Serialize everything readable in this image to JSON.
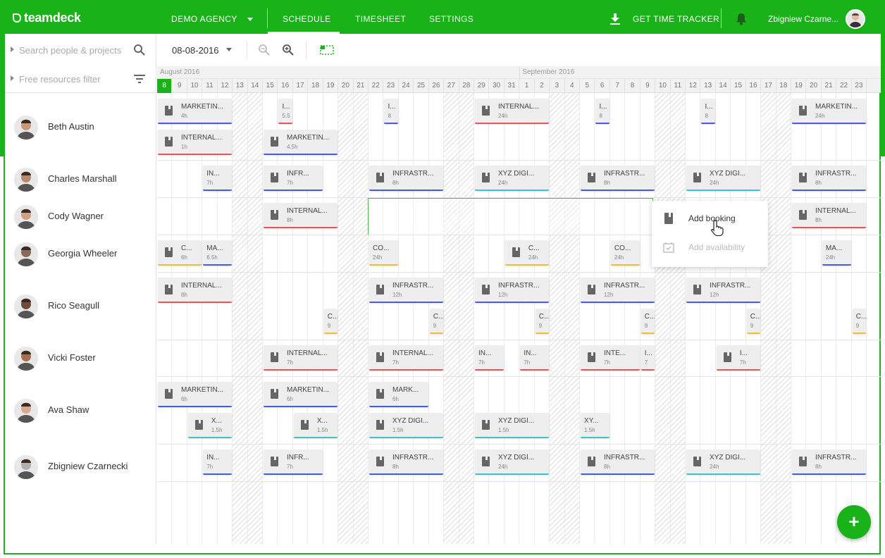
{
  "header": {
    "logo": "teamdeck",
    "agency": "DEMO AGENCY",
    "tabs": [
      {
        "label": "SCHEDULE",
        "active": true
      },
      {
        "label": "TIMESHEET",
        "active": false
      },
      {
        "label": "SETTINGS",
        "active": false
      }
    ],
    "tracker": "GET TIME TRACKER",
    "user": "Zbigniew Czarne..."
  },
  "sidebar": {
    "search_placeholder": "Search people & projects",
    "filter_placeholder": "Free resources filter",
    "people": [
      {
        "name": "Beth Austin"
      },
      {
        "name": "Charles Marshall"
      },
      {
        "name": "Cody Wagner"
      },
      {
        "name": "Georgia Wheeler"
      },
      {
        "name": "Rico Seagull"
      },
      {
        "name": "Vicki Foster"
      },
      {
        "name": "Ava Shaw"
      },
      {
        "name": "Zbigniew Czarnecki"
      }
    ]
  },
  "toolbar": {
    "date": "08-08-2016"
  },
  "timeline": {
    "months": [
      {
        "label": "August 2016",
        "start": 0
      },
      {
        "label": "September 2016",
        "start": 24
      }
    ],
    "days": [
      "8",
      "9",
      "10",
      "11",
      "12",
      "13",
      "14",
      "15",
      "16",
      "17",
      "18",
      "19",
      "20",
      "21",
      "22",
      "23",
      "24",
      "25",
      "26",
      "27",
      "28",
      "29",
      "30",
      "31",
      "1",
      "2",
      "3",
      "4",
      "5",
      "6",
      "7",
      "8",
      "9",
      "10",
      "11",
      "12",
      "13",
      "14",
      "15",
      "16",
      "17",
      "18",
      "19",
      "20",
      "21",
      "22",
      "23"
    ],
    "weekends": [
      5,
      6,
      12,
      13,
      19,
      20,
      26,
      27,
      33,
      34,
      40,
      41
    ],
    "today": 0
  },
  "context_menu": {
    "add_booking": "Add booking",
    "add_availability": "Add availability"
  },
  "colors": {
    "brand": "#19b319",
    "blue": "#4a5bdc",
    "red": "#e05a5a",
    "teal": "#3cc6c6",
    "yellow": "#e8c23a",
    "purple": "#7a88d6"
  },
  "bookings": [
    {
      "title": "MARKETIN...",
      "hours": "4h",
      "color": "blue",
      "row": 0,
      "lane": 0,
      "start": 0,
      "span": 5
    },
    {
      "title": "I...",
      "hours": "5.5",
      "color": "red",
      "row": 0,
      "lane": 0,
      "start": 8,
      "span": 1
    },
    {
      "title": "I...",
      "hours": "8",
      "color": "blue",
      "row": 0,
      "lane": 0,
      "start": 15,
      "span": 1
    },
    {
      "title": "INTERNAL...",
      "hours": "24h",
      "color": "red",
      "row": 0,
      "lane": 0,
      "start": 21,
      "span": 5
    },
    {
      "title": "I...",
      "hours": "8",
      "color": "blue",
      "row": 0,
      "lane": 0,
      "start": 29,
      "span": 1
    },
    {
      "title": "I...",
      "hours": "8",
      "color": "blue",
      "row": 0,
      "lane": 0,
      "start": 36,
      "span": 1
    },
    {
      "title": "MARKETIN...",
      "hours": "24h",
      "color": "blue",
      "row": 0,
      "lane": 0,
      "start": 42,
      "span": 5
    },
    {
      "title": "INTERNAL...",
      "hours": "1h",
      "color": "red",
      "row": 0,
      "lane": 1,
      "start": 0,
      "span": 5
    },
    {
      "title": "MARKETIN...",
      "hours": "4.5h",
      "color": "blue",
      "row": 0,
      "lane": 1,
      "start": 7,
      "span": 5
    },
    {
      "title": "IN...",
      "hours": "7h",
      "color": "blue",
      "row": 1,
      "lane": 0,
      "start": 3,
      "span": 2
    },
    {
      "title": "INFR...",
      "hours": "7h",
      "color": "blue",
      "row": 1,
      "lane": 0,
      "start": 7,
      "span": 4
    },
    {
      "title": "INFRASTR...",
      "hours": "8h",
      "color": "blue",
      "row": 1,
      "lane": 0,
      "start": 14,
      "span": 5
    },
    {
      "title": "XYZ DIGI...",
      "hours": "24h",
      "color": "teal",
      "row": 1,
      "lane": 0,
      "start": 21,
      "span": 5
    },
    {
      "title": "INFRASTR...",
      "hours": "8h",
      "color": "blue",
      "row": 1,
      "lane": 0,
      "start": 28,
      "span": 5
    },
    {
      "title": "XYZ DIGI...",
      "hours": "24h",
      "color": "teal",
      "row": 1,
      "lane": 0,
      "start": 35,
      "span": 5
    },
    {
      "title": "INFRASTR...",
      "hours": "8h",
      "color": "blue",
      "row": 1,
      "lane": 0,
      "start": 42,
      "span": 5
    },
    {
      "title": "INTERNAL...",
      "hours": "8h",
      "color": "red",
      "row": 2,
      "lane": 0,
      "start": 7,
      "span": 5
    },
    {
      "title": "INTERNAL...",
      "hours": "8h",
      "color": "red",
      "row": 2,
      "lane": 0,
      "start": 42,
      "span": 5
    },
    {
      "title": "C...",
      "hours": "6h",
      "color": "yellow",
      "row": 3,
      "lane": 0,
      "start": 0,
      "span": 3
    },
    {
      "title": "MA...",
      "hours": "6.5h",
      "color": "blue",
      "row": 3,
      "lane": 0,
      "start": 3,
      "span": 2
    },
    {
      "title": "CO...",
      "hours": "24h",
      "color": "yellow",
      "row": 3,
      "lane": 0,
      "start": 14,
      "span": 2
    },
    {
      "title": "C...",
      "hours": "24h",
      "color": "yellow",
      "row": 3,
      "lane": 0,
      "start": 23,
      "span": 3
    },
    {
      "title": "CO...",
      "hours": "24h",
      "color": "yellow",
      "row": 3,
      "lane": 0,
      "start": 30,
      "span": 2
    },
    {
      "title": "MA...",
      "hours": "24h",
      "color": "blue",
      "row": 3,
      "lane": 0,
      "start": 44,
      "span": 2
    },
    {
      "title": "INTERNAL...",
      "hours": "8h",
      "color": "red",
      "row": 4,
      "lane": 0,
      "start": 0,
      "span": 5
    },
    {
      "title": "INFRASTR...",
      "hours": "12h",
      "color": "blue",
      "row": 4,
      "lane": 0,
      "start": 14,
      "span": 5
    },
    {
      "title": "INFRASTR...",
      "hours": "12h",
      "color": "blue",
      "row": 4,
      "lane": 0,
      "start": 21,
      "span": 5
    },
    {
      "title": "INFRASTR...",
      "hours": "12h",
      "color": "blue",
      "row": 4,
      "lane": 0,
      "start": 28,
      "span": 5
    },
    {
      "title": "INFRASTR...",
      "hours": "12h",
      "color": "blue",
      "row": 4,
      "lane": 0,
      "start": 35,
      "span": 5
    },
    {
      "title": "C...",
      "hours": "9",
      "color": "yellow",
      "row": 4,
      "lane": 1,
      "start": 11,
      "span": 1
    },
    {
      "title": "C...",
      "hours": "9",
      "color": "yellow",
      "row": 4,
      "lane": 1,
      "start": 18,
      "span": 1
    },
    {
      "title": "C...",
      "hours": "9",
      "color": "yellow",
      "row": 4,
      "lane": 1,
      "start": 25,
      "span": 1
    },
    {
      "title": "C...",
      "hours": "9",
      "color": "yellow",
      "row": 4,
      "lane": 1,
      "start": 32,
      "span": 1
    },
    {
      "title": "C...",
      "hours": "9",
      "color": "yellow",
      "row": 4,
      "lane": 1,
      "start": 39,
      "span": 1
    },
    {
      "title": "C...",
      "hours": "9",
      "color": "yellow",
      "row": 4,
      "lane": 1,
      "start": 46,
      "span": 1
    },
    {
      "title": "INTERNAL...",
      "hours": "7h",
      "color": "red",
      "row": 5,
      "lane": 0,
      "start": 7,
      "span": 5
    },
    {
      "title": "INTERNAL...",
      "hours": "7h",
      "color": "red",
      "row": 5,
      "lane": 0,
      "start": 14,
      "span": 5
    },
    {
      "title": "IN...",
      "hours": "7h",
      "color": "red",
      "row": 5,
      "lane": 0,
      "start": 21,
      "span": 2
    },
    {
      "title": "IN...",
      "hours": "7h",
      "color": "red",
      "row": 5,
      "lane": 0,
      "start": 24,
      "span": 2
    },
    {
      "title": "INTE...",
      "hours": "7h",
      "color": "red",
      "row": 5,
      "lane": 0,
      "start": 28,
      "span": 4
    },
    {
      "title": "I...",
      "hours": "7",
      "color": "red",
      "row": 5,
      "lane": 0,
      "start": 32,
      "span": 1
    },
    {
      "title": "I...",
      "hours": "7h",
      "color": "red",
      "row": 5,
      "lane": 0,
      "start": 37,
      "span": 3
    },
    {
      "title": "MARKETIN...",
      "hours": "6h",
      "color": "blue",
      "row": 6,
      "lane": 0,
      "start": 0,
      "span": 5
    },
    {
      "title": "MARKETIN...",
      "hours": "6h",
      "color": "blue",
      "row": 6,
      "lane": 0,
      "start": 7,
      "span": 5
    },
    {
      "title": "MARK...",
      "hours": "6h",
      "color": "blue",
      "row": 6,
      "lane": 0,
      "start": 14,
      "span": 4
    },
    {
      "title": "X...",
      "hours": "1.5h",
      "color": "teal",
      "row": 6,
      "lane": 1,
      "start": 2,
      "span": 3
    },
    {
      "title": "X...",
      "hours": "1.5h",
      "color": "teal",
      "row": 6,
      "lane": 1,
      "start": 9,
      "span": 3
    },
    {
      "title": "XYZ DIGI...",
      "hours": "1.5h",
      "color": "teal",
      "row": 6,
      "lane": 1,
      "start": 14,
      "span": 5
    },
    {
      "title": "XYZ DIGI...",
      "hours": "1.5h",
      "color": "teal",
      "row": 6,
      "lane": 1,
      "start": 21,
      "span": 5
    },
    {
      "title": "XY...",
      "hours": "1.5h",
      "color": "teal",
      "row": 6,
      "lane": 1,
      "start": 28,
      "span": 2
    },
    {
      "title": "IN...",
      "hours": "7h",
      "color": "blue",
      "row": 7,
      "lane": 0,
      "start": 3,
      "span": 2
    },
    {
      "title": "INFR...",
      "hours": "7h",
      "color": "blue",
      "row": 7,
      "lane": 0,
      "start": 7,
      "span": 4
    },
    {
      "title": "INFRASTR...",
      "hours": "8h",
      "color": "blue",
      "row": 7,
      "lane": 0,
      "start": 14,
      "span": 5
    },
    {
      "title": "XYZ DIGI...",
      "hours": "24h",
      "color": "teal",
      "row": 7,
      "lane": 0,
      "start": 21,
      "span": 5
    },
    {
      "title": "INFRASTR...",
      "hours": "8h",
      "color": "blue",
      "row": 7,
      "lane": 0,
      "start": 28,
      "span": 5
    },
    {
      "title": "XYZ DIGI...",
      "hours": "24h",
      "color": "teal",
      "row": 7,
      "lane": 0,
      "start": 35,
      "span": 5
    },
    {
      "title": "INFRASTR...",
      "hours": "8h",
      "color": "blue",
      "row": 7,
      "lane": 0,
      "start": 42,
      "span": 5
    }
  ]
}
